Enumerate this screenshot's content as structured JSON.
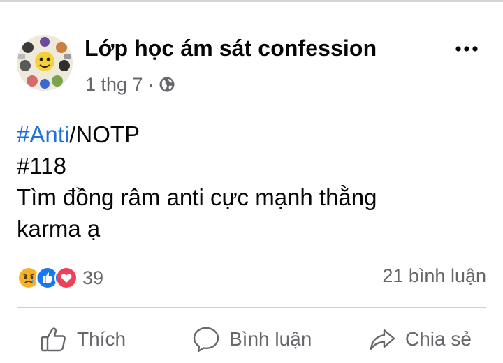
{
  "post": {
    "page_name": "Lớp học ám sát confession",
    "time": "1 thg 7",
    "separator": "·",
    "privacy_icon": "globe-icon",
    "more_icon": "more-dots-icon",
    "avatar_icon": "avatar-collage",
    "body": {
      "line1_hashtag": "#Anti",
      "line1_rest": "/NOTP",
      "line2": "#118",
      "line3": "Tìm đồng râm anti cực mạnh thằng",
      "line4": "karma ạ"
    },
    "stats": {
      "reactions": [
        "sad-reaction-icon",
        "like-reaction-icon",
        "love-reaction-icon"
      ],
      "reaction_count": "39",
      "comments": "21 bình luận"
    },
    "actions": {
      "like": "Thích",
      "comment": "Bình luận",
      "share": "Chia sẻ"
    }
  },
  "colors": {
    "hashtag": "#216fdb",
    "secondary_text": "#65676b",
    "like_blue": "#1877f2",
    "love_red": "#f33e58",
    "sad_yellow": "#f7b125"
  }
}
